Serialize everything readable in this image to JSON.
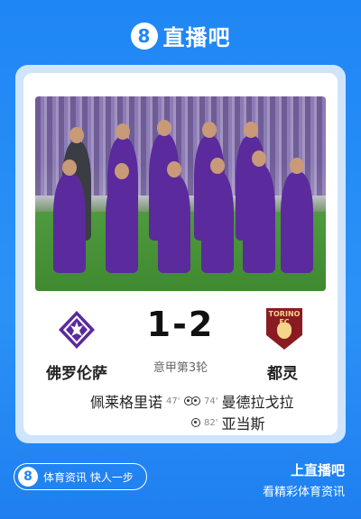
{
  "brand": {
    "logo_glyph": "8",
    "name": "直播吧"
  },
  "match": {
    "home": {
      "name": "佛罗伦萨",
      "logo": "fiorentina-crest-icon"
    },
    "away": {
      "name": "都灵",
      "logo": "torino-crest-icon",
      "crest_text": "TORINO FC"
    },
    "score": "1-2",
    "round": "意甲第3轮",
    "events": [
      {
        "side": "home",
        "player": "佩莱格里诺",
        "minute": "47'",
        "icon": "soccer-ball-icon"
      },
      {
        "side": "away",
        "player": "曼德拉戈拉",
        "minute": "74'",
        "icon": "soccer-ball-icon"
      },
      {
        "side": "away",
        "player": "亚当斯",
        "minute": "82'",
        "icon": "soccer-ball-icon"
      }
    ]
  },
  "footer": {
    "pill_logo_glyph": "8",
    "pill_text": "体育资讯 快人一步",
    "right_line1": "上直播吧",
    "right_line2": "看精彩体育资讯"
  },
  "colors": {
    "background": "#1f86f5",
    "card": "#ffffff",
    "home": "#5b2a9c",
    "away": "#8a1b22"
  }
}
